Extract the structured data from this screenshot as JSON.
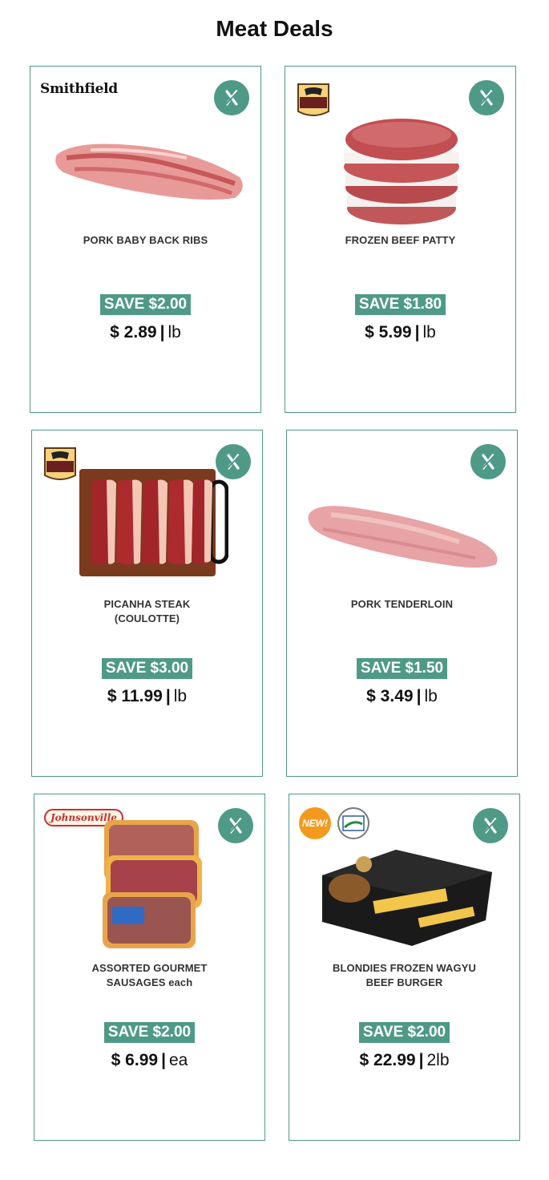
{
  "page": {
    "title": "Meat Deals"
  },
  "brand_text": {
    "smithfield": "Smithfield",
    "johnsonville": "Johnsonville",
    "new_badge": "NEW!"
  },
  "colors": {
    "accent": "#4e9a86",
    "new_badge": "#f39a1e"
  },
  "icons": {
    "corner_badge": "crossed-out-icon"
  },
  "deals": [
    {
      "name": "PORK BABY BACK RIBS",
      "save": "SAVE $2.00",
      "price": "$ 2.89",
      "unit": "lb",
      "brand": "smithfield"
    },
    {
      "name": "FROZEN BEEF PATTY",
      "save": "SAVE $1.80",
      "price": "$ 5.99",
      "unit": "lb",
      "brand": "certified-angus-beef"
    },
    {
      "name": "PICANHA STEAK (COULOTTE)",
      "save": "SAVE $3.00",
      "price": "$ 11.99",
      "unit": "lb",
      "brand": "certified-angus-beef"
    },
    {
      "name": "PORK TENDERLOIN",
      "save": "SAVE $1.50",
      "price": "$ 3.49",
      "unit": "lb",
      "brand": ""
    },
    {
      "name": "ASSORTED GOURMET SAUSAGES each",
      "save": "SAVE $2.00",
      "price": "$ 6.99",
      "unit": "ea",
      "brand": "johnsonville"
    },
    {
      "name": "BLONDIES FROZEN WAGYU BEEF BURGER",
      "save": "SAVE $2.00",
      "price": "$ 22.99",
      "unit": "2lb",
      "brand": "usda"
    }
  ]
}
